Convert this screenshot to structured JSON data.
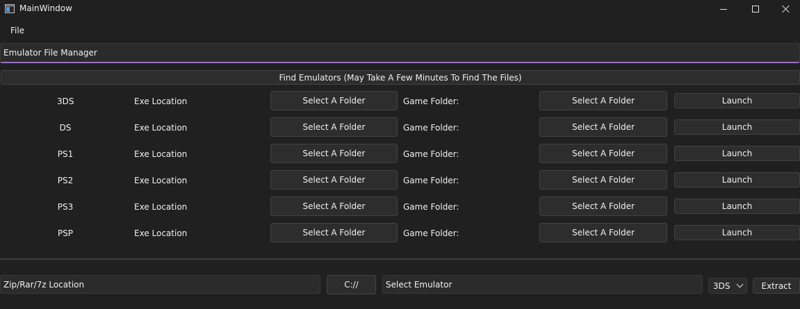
{
  "window": {
    "title": "MainWindow"
  },
  "menu": {
    "file": "File"
  },
  "header": {
    "title": "Emulator File Manager"
  },
  "find_button": "Find Emulators (May Take A Few Minutes To Find The Files)",
  "emulators": [
    {
      "name": "3DS",
      "exe_label": "Exe Location",
      "exe_button": "Select A Folder",
      "game_label": "Game Folder:",
      "game_button": "Select A Folder",
      "launch": "Launch"
    },
    {
      "name": "DS",
      "exe_label": "Exe Location",
      "exe_button": "Select A Folder",
      "game_label": "Game Folder:",
      "game_button": "Select A Folder",
      "launch": "Launch"
    },
    {
      "name": "PS1",
      "exe_label": "Exe Location",
      "exe_button": "Select A Folder",
      "game_label": "Game Folder:",
      "game_button": "Select A Folder",
      "launch": "Launch"
    },
    {
      "name": "PS2",
      "exe_label": "Exe Location",
      "exe_button": "Select A Folder",
      "game_label": "Game Folder:",
      "game_button": "Select A Folder",
      "launch": "Launch"
    },
    {
      "name": "PS3",
      "exe_label": "Exe Location",
      "exe_button": "Select A Folder",
      "game_label": "Game Folder:",
      "game_button": "Select A Folder",
      "launch": "Launch"
    },
    {
      "name": "PSP",
      "exe_label": "Exe Location",
      "exe_button": "Select A Folder",
      "game_label": "Game Folder:",
      "game_button": "Select A Folder",
      "launch": "Launch"
    }
  ],
  "extract": {
    "zip_location": "Zip/Rar/7z Location",
    "path_button": "C://",
    "select_emulator": "Select Emulator",
    "dropdown_value": "3DS",
    "extract_button": "Extract"
  },
  "colors": {
    "background": "#202020",
    "accent": "#9b6fc2"
  }
}
